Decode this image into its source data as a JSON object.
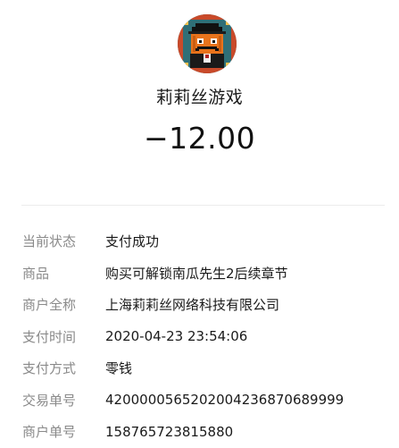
{
  "merchant": {
    "avatar_icon": "pumpkin-gentleman-avatar-icon",
    "name": "莉莉丝游戏"
  },
  "payment": {
    "amount": "−12.00"
  },
  "details": [
    {
      "label": "当前状态",
      "value": "支付成功"
    },
    {
      "label": "商品",
      "value": "购买可解锁南瓜先生2后续章节"
    },
    {
      "label": "商户全称",
      "value": "上海莉莉丝网络科技有限公司"
    },
    {
      "label": "支付时间",
      "value": "2020-04-23 23:54:06"
    },
    {
      "label": "支付方式",
      "value": "零钱"
    },
    {
      "label": "交易单号",
      "value": "4200000565202004236870689999"
    },
    {
      "label": "商户单号",
      "value": "158765723815880"
    }
  ],
  "colors": {
    "label_gray": "#8a8a8a",
    "text_dark": "#1a1a1a",
    "avatar_bg": "#2f6f77",
    "avatar_pumpkin": "#e8731c"
  }
}
